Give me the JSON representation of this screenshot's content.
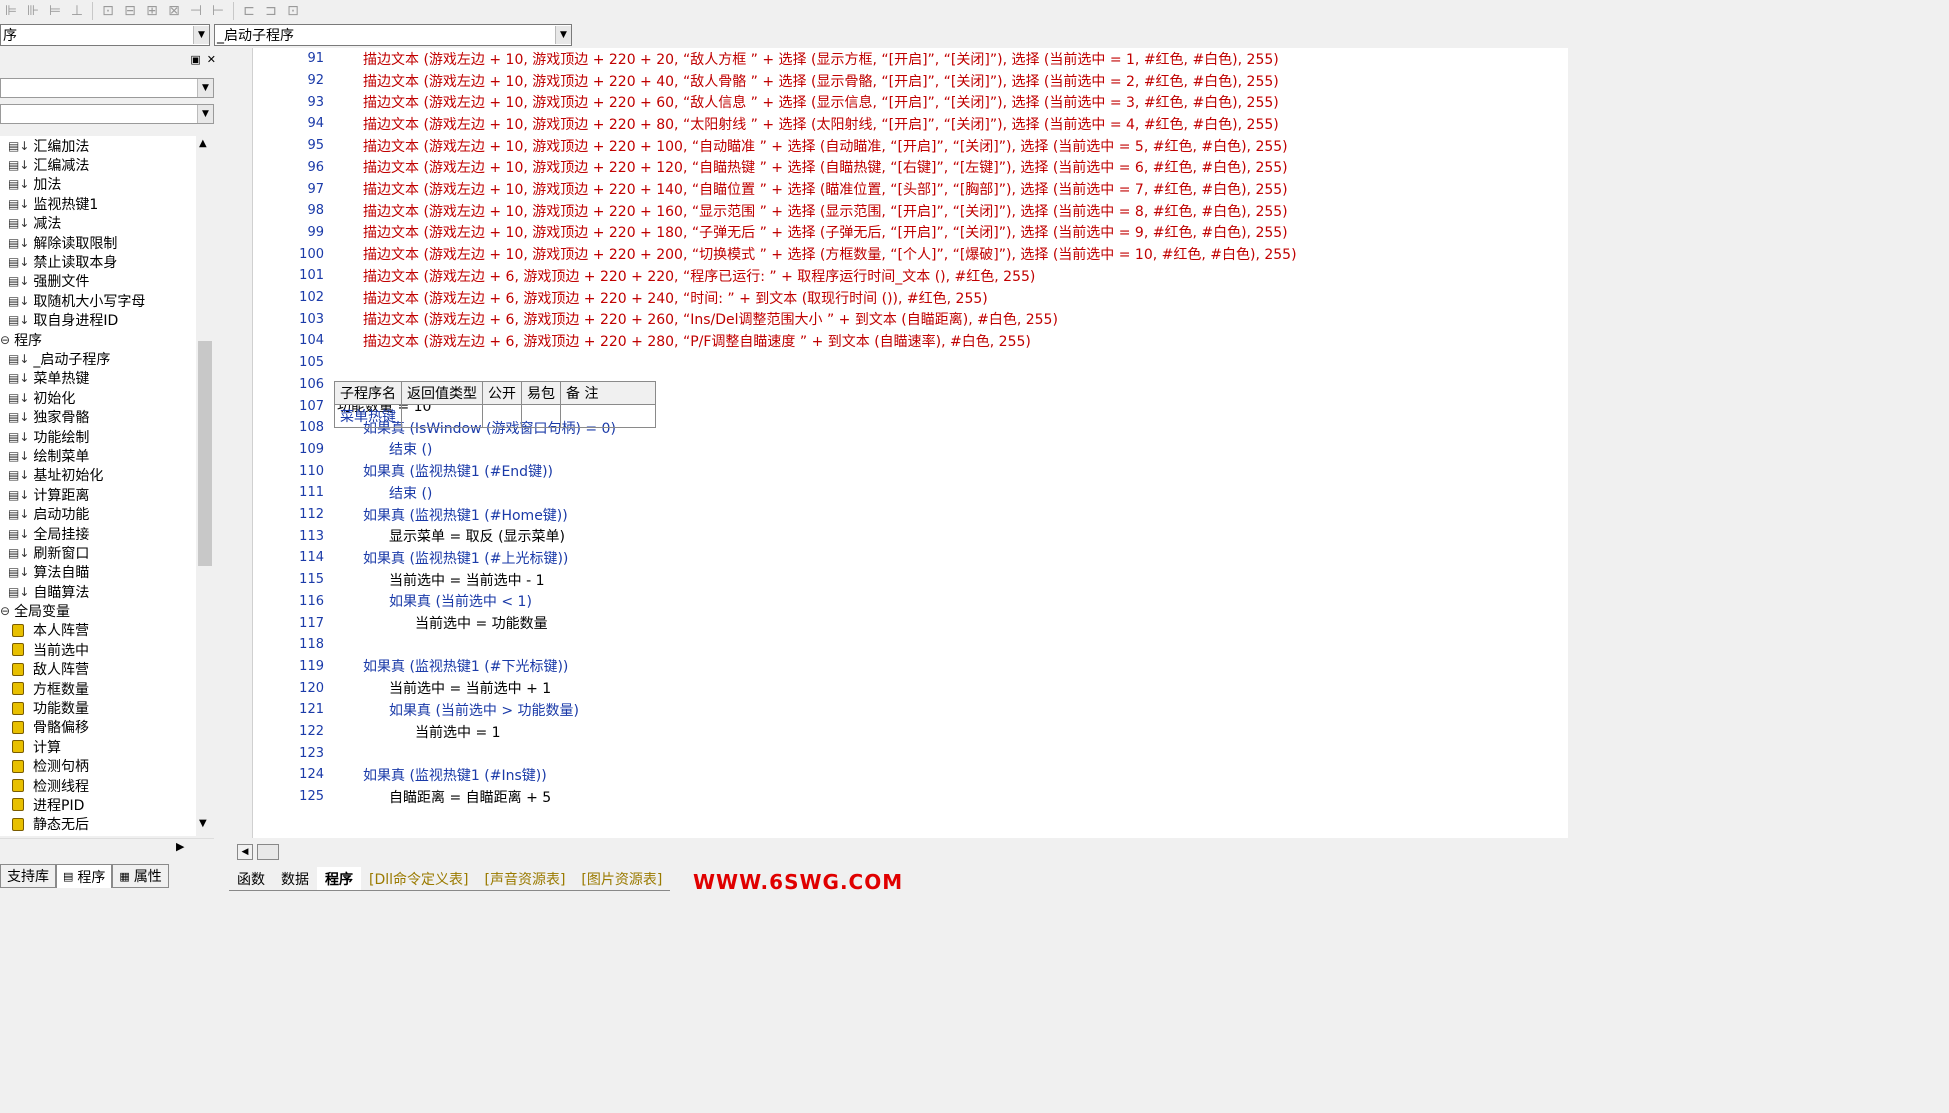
{
  "toolbar": {
    "icons": [
      "align-left-icon",
      "align-center-icon",
      "align-right-icon",
      "align-bottom-icon",
      "size-width-icon",
      "size-height-icon",
      "center-h-icon",
      "center-v-icon",
      "space-h-icon",
      "space-v-icon",
      "fit-width-icon",
      "fit-height-icon",
      "fit-both-icon"
    ]
  },
  "combos": {
    "left": "序",
    "right": "_启动子程序"
  },
  "tree": {
    "items": [
      {
        "label": "汇编加法",
        "kind": "sub"
      },
      {
        "label": "汇编减法",
        "kind": "sub"
      },
      {
        "label": "加法",
        "kind": "sub"
      },
      {
        "label": "监视热键1",
        "kind": "sub"
      },
      {
        "label": "减法",
        "kind": "sub"
      },
      {
        "label": "解除读取限制",
        "kind": "sub"
      },
      {
        "label": "禁止读取本身",
        "kind": "sub"
      },
      {
        "label": "强删文件",
        "kind": "sub"
      },
      {
        "label": "取随机大小写字母",
        "kind": "sub"
      },
      {
        "label": "取自身进程ID",
        "kind": "sub"
      },
      {
        "label": "程序",
        "kind": "group"
      },
      {
        "label": "_启动子程序",
        "kind": "sub"
      },
      {
        "label": "菜单热键",
        "kind": "sub"
      },
      {
        "label": "初始化",
        "kind": "sub"
      },
      {
        "label": "独家骨骼",
        "kind": "sub"
      },
      {
        "label": "功能绘制",
        "kind": "sub"
      },
      {
        "label": "绘制菜单",
        "kind": "sub"
      },
      {
        "label": "基址初始化",
        "kind": "sub"
      },
      {
        "label": "计算距离",
        "kind": "sub"
      },
      {
        "label": "启动功能",
        "kind": "sub"
      },
      {
        "label": "全局挂接",
        "kind": "sub"
      },
      {
        "label": "刷新窗口",
        "kind": "sub"
      },
      {
        "label": "算法自瞄",
        "kind": "sub"
      },
      {
        "label": "自瞄算法",
        "kind": "sub"
      },
      {
        "label": "全局变量",
        "kind": "group"
      },
      {
        "label": "本人阵营",
        "kind": "var"
      },
      {
        "label": "当前选中",
        "kind": "var"
      },
      {
        "label": "敌人阵营",
        "kind": "var"
      },
      {
        "label": "方框数量",
        "kind": "var"
      },
      {
        "label": "功能数量",
        "kind": "var"
      },
      {
        "label": "骨骼偏移",
        "kind": "var"
      },
      {
        "label": "计算",
        "kind": "var"
      },
      {
        "label": "检测句柄",
        "kind": "var"
      },
      {
        "label": "检测线程",
        "kind": "var"
      },
      {
        "label": "进程PID",
        "kind": "var"
      },
      {
        "label": "静态无后",
        "kind": "var"
      }
    ]
  },
  "left_tabs": [
    "支持库",
    "程序",
    "属性"
  ],
  "table": {
    "headers": [
      "子程序名",
      "返回值类型",
      "公开",
      "易包",
      "备 注"
    ],
    "row": [
      "菜单热键",
      "",
      "",
      "",
      ""
    ]
  },
  "lines": [
    {
      "n": "91",
      "t": "描边文本 (游戏左边 + 10, 游戏顶边 + 220 + 20, “敌人方框 ” + 选择 (显示方框, “[开启]”, “[关闭]”), 选择 (当前选中 = 1, #红色, #白色), 255)"
    },
    {
      "n": "92",
      "t": "描边文本 (游戏左边 + 10, 游戏顶边 + 220 + 40, “敌人骨骼 ” + 选择 (显示骨骼, “[开启]”, “[关闭]”), 选择 (当前选中 = 2, #红色, #白色), 255)"
    },
    {
      "n": "93",
      "t": "描边文本 (游戏左边 + 10, 游戏顶边 + 220 + 60, “敌人信息 ” + 选择 (显示信息, “[开启]”, “[关闭]”), 选择 (当前选中 = 3, #红色, #白色), 255)"
    },
    {
      "n": "94",
      "t": "描边文本 (游戏左边 + 10, 游戏顶边 + 220 + 80, “太阳射线 ” + 选择 (太阳射线, “[开启]”, “[关闭]”), 选择 (当前选中 = 4, #红色, #白色), 255)"
    },
    {
      "n": "95",
      "t": "描边文本 (游戏左边 + 10, 游戏顶边 + 220 + 100, “自动瞄准 ” + 选择 (自动瞄准, “[开启]”, “[关闭]”), 选择 (当前选中 = 5, #红色, #白色), 255)"
    },
    {
      "n": "96",
      "t": "描边文本 (游戏左边 + 10, 游戏顶边 + 220 + 120, “自瞄热键 ” + 选择 (自瞄热键, “[右键]”, “[左键]”), 选择 (当前选中 = 6, #红色, #白色), 255)"
    },
    {
      "n": "97",
      "t": "描边文本 (游戏左边 + 10, 游戏顶边 + 220 + 140, “自瞄位置 ” + 选择 (瞄准位置, “[头部]”, “[胸部]”), 选择 (当前选中 = 7, #红色, #白色), 255)"
    },
    {
      "n": "98",
      "t": "描边文本 (游戏左边 + 10, 游戏顶边 + 220 + 160, “显示范围 ” + 选择 (显示范围, “[开启]”, “[关闭]”), 选择 (当前选中 = 8, #红色, #白色), 255)"
    },
    {
      "n": "99",
      "t": "描边文本 (游戏左边 + 10, 游戏顶边 + 220 + 180, “子弹无后 ” + 选择 (子弹无后, “[开启]”, “[关闭]”), 选择 (当前选中 = 9, #红色, #白色), 255)"
    },
    {
      "n": "100",
      "t": "描边文本 (游戏左边 + 10, 游戏顶边 + 220 + 200, “切换模式 ” + 选择 (方框数量, “[个人]”, “[爆破]”), 选择 (当前选中 = 10, #红色, #白色), 255)"
    },
    {
      "n": "101",
      "t": "描边文本 (游戏左边 + 6, 游戏顶边 + 220 + 220, “程序已运行: ” + 取程序运行时间_文本 (), #红色, 255)"
    },
    {
      "n": "102",
      "t": "描边文本 (游戏左边 + 6, 游戏顶边 + 220 + 240, “时间: ” + 到文本 (取现行时间 ()), #红色, 255)"
    },
    {
      "n": "103",
      "t": "描边文本 (游戏左边 + 6, 游戏顶边 + 220 + 260, “Ins/Del调整范围大小 ” + 到文本 (自瞄距离), #白色, 255)"
    },
    {
      "n": "104",
      "t": "描边文本 (游戏左边 + 6, 游戏顶边 + 220 + 280, “P/F调整自瞄速度 ” + 到文本 (自瞄速率), #白色, 255)"
    },
    {
      "n": "105",
      "t": ""
    },
    {
      "n": "106",
      "t": ""
    },
    {
      "n": "107",
      "t": "功能数量 = 10"
    },
    {
      "n": "108",
      "t": "如果真 (IsWindow (游戏窗口句柄) = 0)"
    },
    {
      "n": "109",
      "t": "结束 ()"
    },
    {
      "n": "110",
      "t": "如果真 (监视热键1 (#End键))"
    },
    {
      "n": "111",
      "t": "结束 ()"
    },
    {
      "n": "112",
      "t": "如果真 (监视热键1 (#Home键))"
    },
    {
      "n": "113",
      "t": "显示菜单 = 取反 (显示菜单)"
    },
    {
      "n": "114",
      "t": "如果真 (监视热键1 (#上光标键))"
    },
    {
      "n": "115",
      "t": "当前选中 = 当前选中 - 1"
    },
    {
      "n": "116",
      "t": "如果真 (当前选中 < 1)"
    },
    {
      "n": "117",
      "t": "当前选中 = 功能数量"
    },
    {
      "n": "118",
      "t": ""
    },
    {
      "n": "119",
      "t": "如果真 (监视热键1 (#下光标键))"
    },
    {
      "n": "120",
      "t": "当前选中 = 当前选中 + 1"
    },
    {
      "n": "121",
      "t": "如果真 (当前选中 > 功能数量)"
    },
    {
      "n": "122",
      "t": "当前选中 = 1"
    },
    {
      "n": "123",
      "t": ""
    },
    {
      "n": "124",
      "t": "如果真 (监视热键1 (#Ins键))"
    },
    {
      "n": "125",
      "t": "自瞄距离 = 自瞄距离 + 5"
    }
  ],
  "editor_tabs": [
    "函数",
    "数据",
    "程序",
    "[Dll命令定义表]",
    "[声音资源表]",
    "[图片资源表]"
  ],
  "watermark": "WWW.6SWG.COM"
}
